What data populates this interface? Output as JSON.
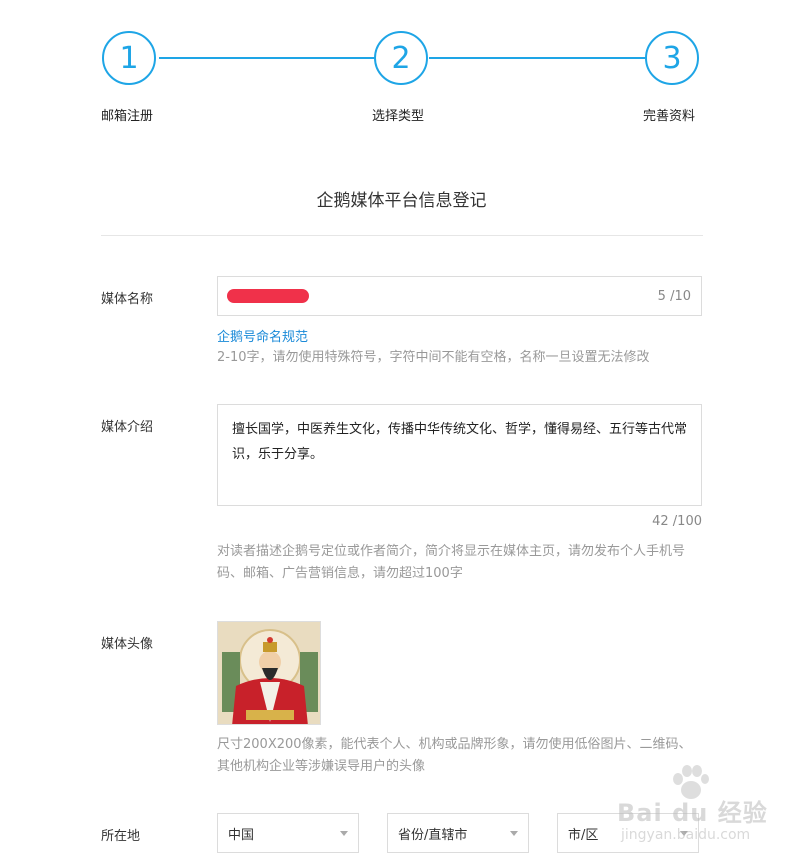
{
  "steps": [
    {
      "number": "1",
      "label": "邮箱注册"
    },
    {
      "number": "2",
      "label": "选择类型"
    },
    {
      "number": "3",
      "label": "完善资料"
    }
  ],
  "page_title": "企鹅媒体平台信息登记",
  "colors": {
    "accent": "#1ea5e6",
    "link": "#1a8ad8",
    "redaction": "#f0314a"
  },
  "media_name": {
    "label": "媒体名称",
    "counter": "5 /10",
    "link": "企鹅号命名规范",
    "hint": "2-10字，请勿使用特殊符号，字符中间不能有空格，名称一旦设置无法修改"
  },
  "media_intro": {
    "label": "媒体介绍",
    "value": "擅长国学，中医养生文化，传播中华传统文化、哲学，懂得易经、五行等古代常识，乐于分享。",
    "counter": "42 /100",
    "hint": "对读者描述企鹅号定位或作者简介，简介将显示在媒体主页，请勿发布个人手机号码、邮箱、广告营销信息，请勿超过100字"
  },
  "media_avatar": {
    "label": "媒体头像",
    "hint": "尺寸200X200像素，能代表个人、机构或品牌形象，请勿使用低俗图片、二维码、其他机构企业等涉嫌误导用户的头像"
  },
  "location": {
    "label": "所在地",
    "country": "中国",
    "province": "省份/直辖市",
    "city": "市/区"
  },
  "watermark": {
    "logo": "Bai du 经验",
    "url": "jingyan.baidu.com"
  }
}
